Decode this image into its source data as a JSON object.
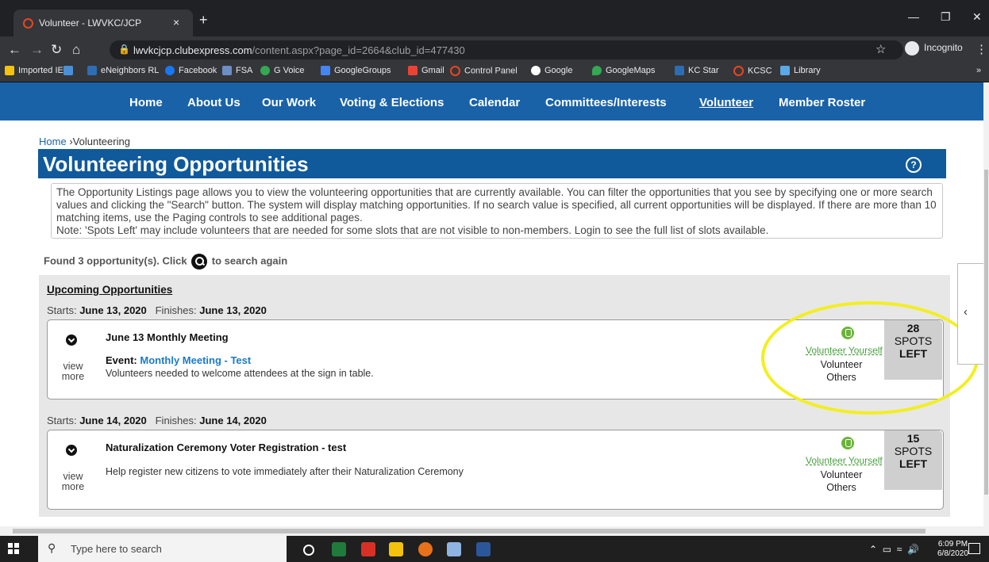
{
  "browser": {
    "tab_title": "Volunteer - LWVKC/JCP",
    "tab_close": "×",
    "new_tab": "+",
    "url_host": "lwvkcjcp.clubexpress.com",
    "url_path": "/content.aspx?page_id=2664&club_id=477430",
    "incognito_label": "Incognito",
    "bookmarks": [
      "Imported IE",
      "eNeighbors RL",
      "Facebook",
      "FSA",
      "G Voice",
      "GoogleGroups",
      "Gmail",
      "Control Panel",
      "Google",
      "GoogleMaps",
      "KC Star",
      "KCSC",
      "Library"
    ],
    "bookmarks_more": "»"
  },
  "site_nav": [
    "Home",
    "About Us",
    "Our Work",
    "Voting & Elections",
    "Calendar",
    "Committees/Interests",
    "Volunteer",
    "Member Roster"
  ],
  "breadcrumb": {
    "home": "Home",
    "sep": "›",
    "current": "Volunteering"
  },
  "page_title": "Volunteering Opportunities",
  "help_glyph": "?",
  "info_text": "The Opportunity Listings page allows you to view the volunteering opportunities that are currently available. You can filter the opportunities that you see by specifying one or more search values and clicking the \"Search\" button. The system will display matching opportunities. If no search value is specified, all current opportunities will be displayed.  If there are more than 10 matching items, use the Paging controls to see additional pages.",
  "info_note": "Note: 'Spots Left' may include volunteers that are needed for some slots that are not visible to non-members. Login to see the full list of slots available.",
  "found": {
    "prefix": "Found 3 opportunity(s). Click",
    "suffix": "to search again"
  },
  "upcoming_label": "Upcoming Opportunities",
  "labels": {
    "starts": "Starts:",
    "finishes": "Finishes:",
    "view": "view",
    "more": "more",
    "event": "Event:",
    "volunteer_yourself": "Volunteer Yourself",
    "volunteer": "Volunteer",
    "others": "Others",
    "spots": "SPOTS",
    "left": "LEFT"
  },
  "opportunities": [
    {
      "starts": "June 13, 2020",
      "finishes": "June 13, 2020",
      "title": "June 13 Monthly Meeting",
      "event_link": "Monthly Meeting - Test",
      "description": "Volunteers needed to welcome attendees at the sign in table.",
      "spots_left": "28"
    },
    {
      "starts": "June 14, 2020",
      "finishes": "June 14, 2020",
      "title": "Naturalization Ceremony Voter Registration - test",
      "description": "Help register new citizens to vote immediately after their Naturalization Ceremony",
      "spots_left": "15"
    }
  ],
  "taskbar": {
    "search_placeholder": "Type here to search",
    "time": "6:09 PM",
    "date": "6/8/2020"
  },
  "colors": {
    "nav_blue": "#1a62a8",
    "title_blue": "#10599b",
    "highlight_circle": "#f2ef1e",
    "volunteer_green": "#4aa040"
  }
}
